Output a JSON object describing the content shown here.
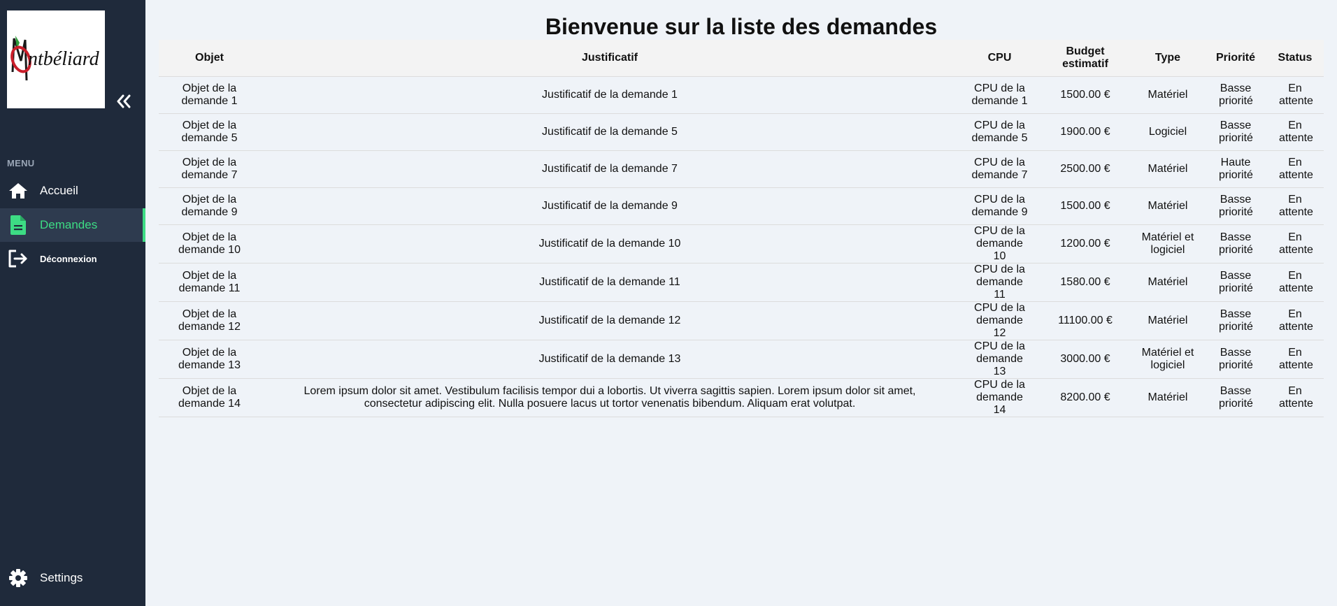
{
  "sidebar": {
    "logo_text": "Montbéliard",
    "menu_label": "MENU",
    "items": [
      {
        "label": "Accueil",
        "icon": "home-icon"
      },
      {
        "label": "Demandes",
        "icon": "document-icon",
        "active": true
      },
      {
        "label": "Déconnexion",
        "icon": "logout-icon"
      }
    ],
    "settings_label": "Settings",
    "accent_color": "#3ddc84",
    "background_color": "#1f2a3b"
  },
  "main": {
    "title": "Bienvenue sur la liste des demandes",
    "table": {
      "headers": [
        "Objet",
        "Justificatif",
        "CPU",
        "Budget estimatif",
        "Type",
        "Priorité",
        "Status"
      ],
      "rows": [
        [
          "Objet de la demande 1",
          "Justificatif de la demande 1",
          "CPU de la demande 1",
          "1500.00 €",
          "Matériel",
          "Basse priorité",
          "En attente"
        ],
        [
          "Objet de la demande 5",
          "Justificatif de la demande 5",
          "CPU de la demande 5",
          "1900.00 €",
          "Logiciel",
          "Basse priorité",
          "En attente"
        ],
        [
          "Objet de la demande 7",
          "Justificatif de la demande 7",
          "CPU de la demande 7",
          "2500.00 €",
          "Matériel",
          "Haute priorité",
          "En attente"
        ],
        [
          "Objet de la demande 9",
          "Justificatif de la demande 9",
          "CPU de la demande 9",
          "1500.00 €",
          "Matériel",
          "Basse priorité",
          "En attente"
        ],
        [
          "Objet de la demande 10",
          "Justificatif de la demande 10",
          "CPU de la demande 10",
          "1200.00 €",
          "Matériel et logiciel",
          "Basse priorité",
          "En attente"
        ],
        [
          "Objet de la demande 11",
          "Justificatif de la demande 11",
          "CPU de la demande 11",
          "1580.00 €",
          "Matériel",
          "Basse priorité",
          "En attente"
        ],
        [
          "Objet de la demande 12",
          "Justificatif de la demande 12",
          "CPU de la demande 12",
          "11100.00 €",
          "Matériel",
          "Basse priorité",
          "En attente"
        ],
        [
          "Objet de la demande 13",
          "Justificatif de la demande 13",
          "CPU de la demande 13",
          "3000.00 €",
          "Matériel et logiciel",
          "Basse priorité",
          "En attente"
        ],
        [
          "Objet de la demande 14",
          "Lorem ipsum dolor sit amet. Vestibulum facilisis tempor dui a lobortis. Ut viverra sagittis sapien. Lorem ipsum dolor sit amet, consectetur adipiscing elit. Nulla posuere lacus ut tortor venenatis bibendum. Aliquam erat volutpat.",
          "CPU de la demande 14",
          "8200.00 €",
          "Matériel",
          "Basse priorité",
          "En attente"
        ]
      ]
    }
  }
}
